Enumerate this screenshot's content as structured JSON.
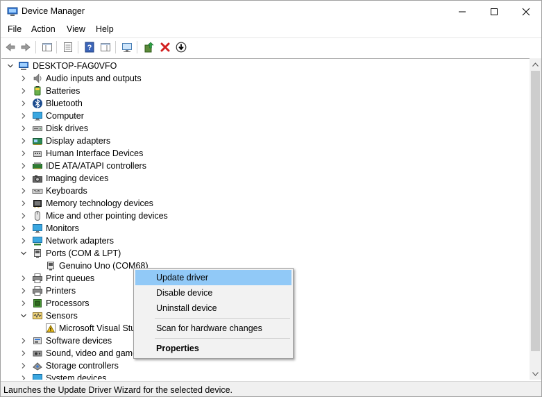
{
  "window": {
    "title": "Device Manager"
  },
  "menu": [
    "File",
    "Action",
    "View",
    "Help"
  ],
  "tree": {
    "root": "DESKTOP-FAG0VFO",
    "items": [
      {
        "label": "Audio inputs and outputs",
        "icon": "speaker-icon"
      },
      {
        "label": "Batteries",
        "icon": "battery-icon"
      },
      {
        "label": "Bluetooth",
        "icon": "bluetooth-icon"
      },
      {
        "label": "Computer",
        "icon": "monitor-icon"
      },
      {
        "label": "Disk drives",
        "icon": "disk-drive-icon"
      },
      {
        "label": "Display adapters",
        "icon": "display-adapter-icon"
      },
      {
        "label": "Human Interface Devices",
        "icon": "hid-icon"
      },
      {
        "label": "IDE ATA/ATAPI controllers",
        "icon": "ide-controller-icon"
      },
      {
        "label": "Imaging devices",
        "icon": "camera-icon"
      },
      {
        "label": "Keyboards",
        "icon": "keyboard-icon"
      },
      {
        "label": "Memory technology devices",
        "icon": "memory-icon"
      },
      {
        "label": "Mice and other pointing devices",
        "icon": "mouse-icon"
      },
      {
        "label": "Monitors",
        "icon": "monitor-icon"
      },
      {
        "label": "Network adapters",
        "icon": "network-icon"
      },
      {
        "label": "Ports (COM & LPT)",
        "icon": "port-icon",
        "expanded": true
      },
      {
        "label": "Genuino Uno (COM68)",
        "icon": "port-icon",
        "child": true
      },
      {
        "label": "Print queues",
        "icon": "printer-icon"
      },
      {
        "label": "Printers",
        "icon": "printer-icon"
      },
      {
        "label": "Processors",
        "icon": "processor-icon"
      },
      {
        "label": "Sensors",
        "icon": "sensor-icon",
        "expanded": true
      },
      {
        "label": "Microsoft Visual Stu",
        "icon": "warning-icon",
        "child": true
      },
      {
        "label": "Software devices",
        "icon": "software-device-icon"
      },
      {
        "label": "Sound, video and game",
        "icon": "sound-icon"
      },
      {
        "label": "Storage controllers",
        "icon": "storage-icon"
      },
      {
        "label": "System devices",
        "icon": "system-icon"
      }
    ]
  },
  "context_menu": {
    "items": [
      "Update driver",
      "Disable device",
      "Uninstall device",
      "Scan for hardware changes",
      "Properties"
    ],
    "highlighted": "Update driver"
  },
  "status": {
    "text": "Launches the Update Driver Wizard for the selected device."
  },
  "colors": {
    "highlight": "#91c9f7",
    "accent": "#0078d7"
  }
}
